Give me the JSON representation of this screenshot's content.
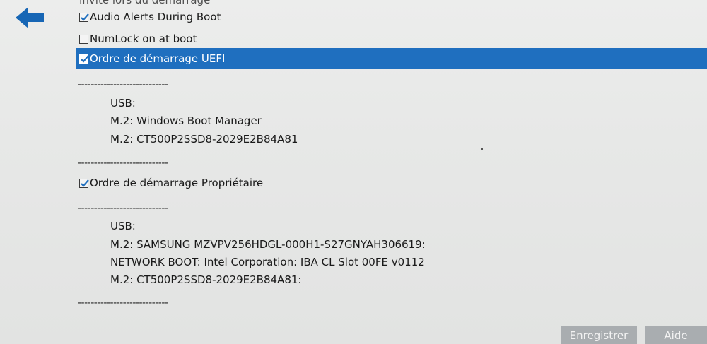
{
  "settings": {
    "cutoff_label": "Invite lors du démarrage",
    "audio_alerts": {
      "label": "Audio Alerts During Boot",
      "checked": true
    },
    "numlock": {
      "label": "NumLock on at boot",
      "checked": false
    },
    "uefi_order": {
      "label": "Ordre de démarrage UEFI",
      "checked": true
    },
    "legacy_order": {
      "label": "Ordre de démarrage Propriétaire",
      "checked": true
    }
  },
  "separator": "----------------------------",
  "uefi_devices": [
    "USB:",
    "M.2:  Windows Boot Manager",
    "M.2:  CT500P2SSD8-2029E2B84A81"
  ],
  "legacy_devices": [
    "USB:",
    "M.2:  SAMSUNG MZVPV256HDGL-000H1-S27GNYAH306619:",
    "NETWORK BOOT:  Intel Corporation: IBA CL Slot 00FE v0112",
    "M.2:  CT500P2SSD8-2029E2B84A81:"
  ],
  "footer": {
    "save_label": "Enregistrer",
    "help_label": "Aide"
  },
  "colors": {
    "selection": "#1f6fbf",
    "back_arrow": "#1766b5",
    "button": "#a9adb0"
  },
  "icons": {
    "back": "back-arrow-icon",
    "check": "checkmark-icon"
  }
}
